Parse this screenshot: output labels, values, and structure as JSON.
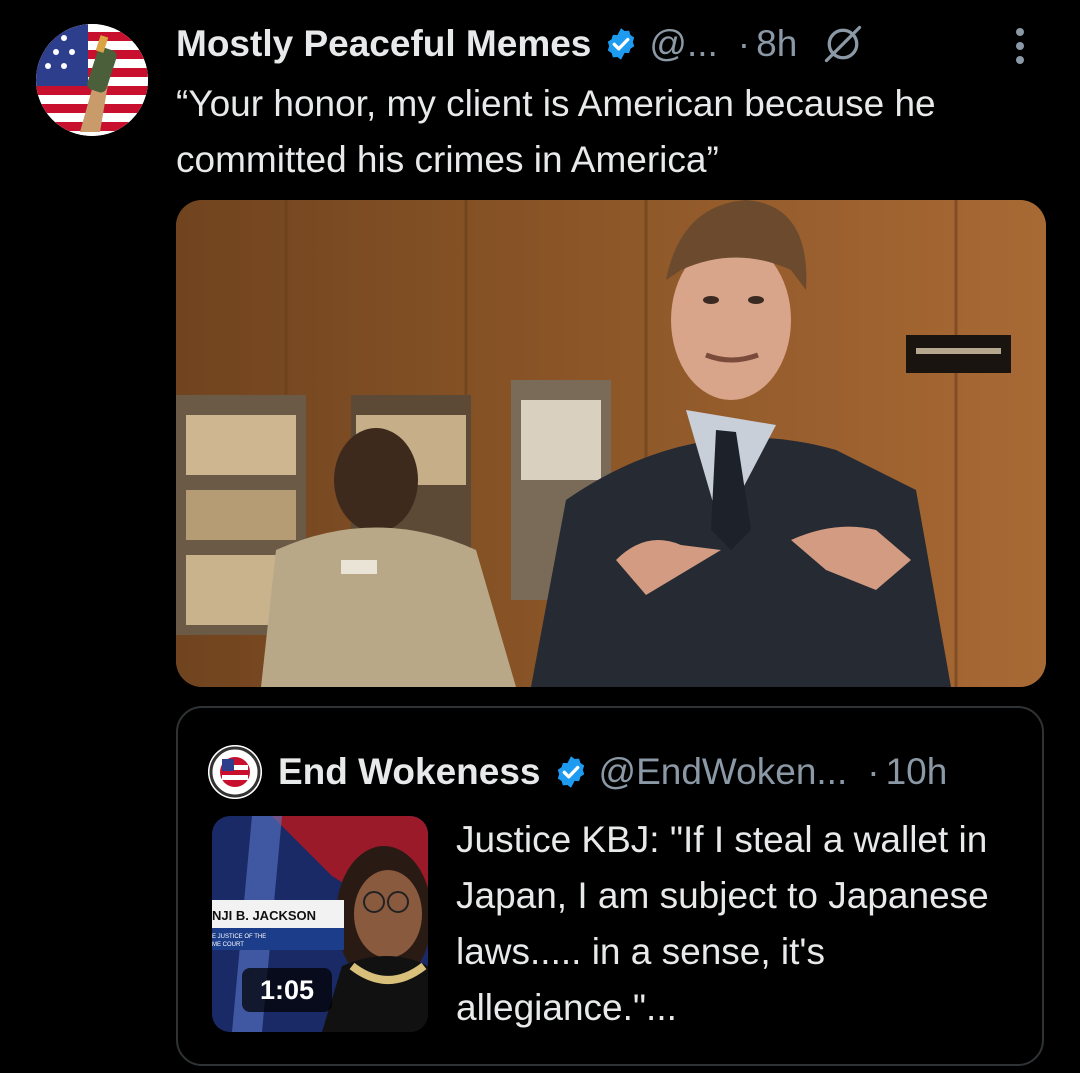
{
  "post": {
    "author_name": "Mostly Peaceful Memes",
    "handle": "@...",
    "time": "8h",
    "text": "“Your honor, my client is American because he committed his crimes in America”",
    "accent_color": "#1d9bf0"
  },
  "quoted_post": {
    "author_name": "End Wokeness",
    "handle": "@EndWoken...",
    "time": "10h",
    "text": "Justice KBJ: \"If I steal a wallet in Japan, I am subject to Japanese laws..... in a sense, it's allegiance.\"...",
    "video_duration": "1:05",
    "thumbnail_caption_name": "NJI B. JACKSON",
    "thumbnail_caption_title_line1": "E JUSTICE OF THE",
    "thumbnail_caption_title_line2": "ME COURT"
  },
  "icons": {
    "verified": "verified-badge-icon",
    "grok": "grok-icon",
    "more": "more-options-icon"
  }
}
